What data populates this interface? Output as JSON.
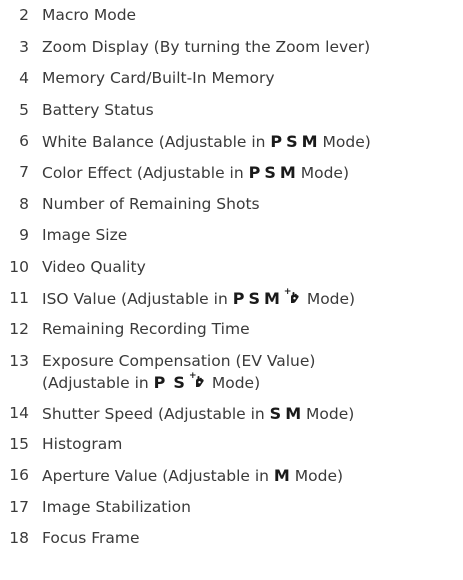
{
  "items": [
    {
      "num": "2",
      "text": "Macro Mode"
    },
    {
      "num": "3",
      "text": "Zoom Display (By turning the Zoom lever)"
    },
    {
      "num": "4",
      "text": "Memory Card/Built-In Memory"
    },
    {
      "num": "5",
      "text": "Battery Status"
    },
    {
      "num": "6",
      "pre": "White Balance (Adjustable in ",
      "modes": [
        "P",
        "S",
        "M"
      ],
      "post": " Mode)"
    },
    {
      "num": "7",
      "pre": "Color Effect (Adjustable in ",
      "modes": [
        "P",
        "S",
        "M"
      ],
      "post": " Mode)"
    },
    {
      "num": "8",
      "text": "Number of Remaining Shots"
    },
    {
      "num": "9",
      "text": "Image Size"
    },
    {
      "num": "10",
      "text": "Video Quality"
    },
    {
      "num": "11",
      "pre": "ISO Value (Adjustable in ",
      "modes": [
        "P",
        "S",
        "M"
      ],
      "scene_icon": "scene-mode-icon",
      "post": " Mode)"
    },
    {
      "num": "12",
      "text": "Remaining Recording Time"
    },
    {
      "num": "13",
      "text": "Exposure Compensation (EV Value)",
      "line2_pre": "(Adjustable in ",
      "modes": [
        "P",
        "S"
      ],
      "scene_icon": "scene-mode-icon",
      "post": " Mode)"
    },
    {
      "num": "14",
      "pre": "Shutter Speed (Adjustable in ",
      "modes": [
        "S",
        "M"
      ],
      "post": " Mode)"
    },
    {
      "num": "15",
      "text": "Histogram"
    },
    {
      "num": "16",
      "pre": "Aperture Value (Adjustable in ",
      "modes": [
        "M"
      ],
      "post": " Mode)"
    },
    {
      "num": "17",
      "text": "Image Stabilization"
    },
    {
      "num": "18",
      "text": "Focus Frame"
    }
  ]
}
